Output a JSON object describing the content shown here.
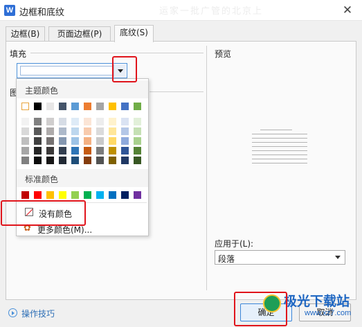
{
  "window": {
    "icon_letter": "W",
    "title": "边框和底纹",
    "faint_text": "运家一批广管的北京上"
  },
  "tabs": [
    {
      "label": "边框(B)",
      "active": false
    },
    {
      "label": "页面边框(P)",
      "active": false
    },
    {
      "label": "底纹(S)",
      "active": true
    }
  ],
  "shading": {
    "fill_label": "填充",
    "pattern_label_fragment": "图",
    "preview_label": "预览"
  },
  "dropdown": {
    "theme_colors_label": "主题颜色",
    "standard_colors_label": "标准颜色",
    "no_color_label": "没有颜色",
    "more_colors_label": "更多颜色(M)...",
    "theme_top_row": [
      "#ffffff",
      "#000000",
      "#e7e6e6",
      "#44546a",
      "#5b9bd5",
      "#ed7d31",
      "#a5a5a5",
      "#ffc000",
      "#4472c4",
      "#70ad47"
    ],
    "theme_shades": [
      [
        "#f2f2f2",
        "#808080",
        "#d0cece",
        "#d6dce5",
        "#deebf7",
        "#fbe5d6",
        "#ededed",
        "#fff2cc",
        "#dae3f3",
        "#e2f0d9"
      ],
      [
        "#d9d9d9",
        "#595959",
        "#aeabab",
        "#adb9ca",
        "#bdd7ee",
        "#f8cbad",
        "#dbdbdb",
        "#ffe699",
        "#b4c7e7",
        "#c5e0b4"
      ],
      [
        "#bfbfbf",
        "#404040",
        "#757171",
        "#8497b0",
        "#9dc3e6",
        "#f4b183",
        "#c9c9c9",
        "#ffd966",
        "#8faadc",
        "#a9d18e"
      ],
      [
        "#a6a6a6",
        "#262626",
        "#3a3838",
        "#333f50",
        "#2e75b6",
        "#c55a11",
        "#7b7b7b",
        "#bf9000",
        "#2f5597",
        "#548235"
      ],
      [
        "#808080",
        "#0d0d0d",
        "#171616",
        "#222a35",
        "#1f4e79",
        "#843c0c",
        "#525252",
        "#7f6000",
        "#203864",
        "#385723"
      ]
    ],
    "standard_row": [
      "#c00000",
      "#ff0000",
      "#ffc000",
      "#ffff00",
      "#92d050",
      "#00b050",
      "#00b0f0",
      "#0070c0",
      "#002060",
      "#7030a0"
    ]
  },
  "apply": {
    "label": "应用于(L):",
    "value": "段落"
  },
  "footer": {
    "tips_label": "操作技巧",
    "ok_label": "确定",
    "cancel_label": "取消"
  },
  "watermark": {
    "text": "极光下载站",
    "url": "www.xz7.com"
  },
  "colors": {
    "highlight": "#e0141b",
    "accent": "#4a90d9",
    "link": "#2e6fb6"
  }
}
